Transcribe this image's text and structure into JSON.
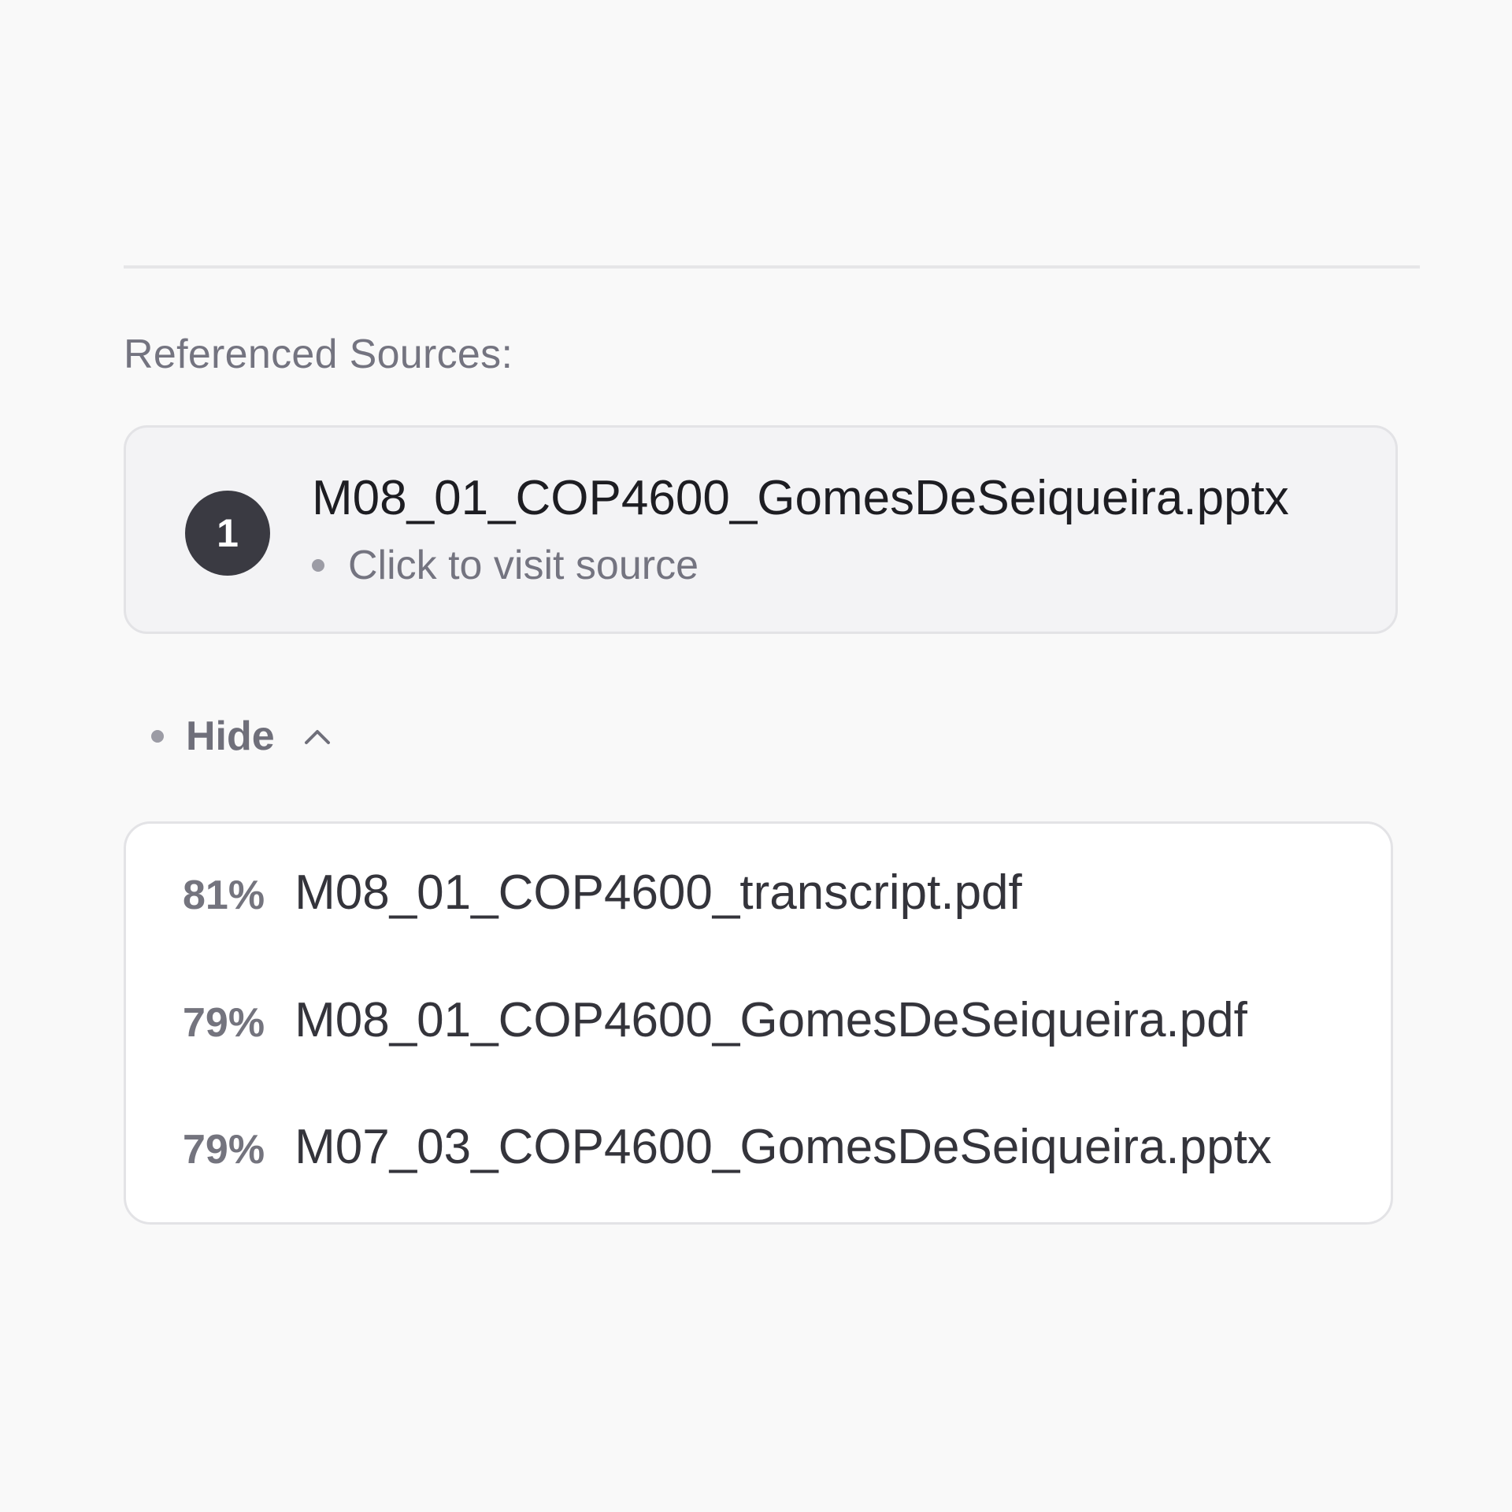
{
  "section_label": "Referenced Sources:",
  "primary_source": {
    "number": "1",
    "title": "M08_01_COP4600_GomesDeSeiqueira.pptx",
    "subtitle": "Click to visit source"
  },
  "toggle": {
    "label": "Hide",
    "icon": "chevron-up-icon"
  },
  "related_sources": [
    {
      "score": "81%",
      "name": "M08_01_COP4600_transcript.pdf"
    },
    {
      "score": "79%",
      "name": "M08_01_COP4600_GomesDeSeiqueira.pdf"
    },
    {
      "score": "79%",
      "name": "M07_03_COP4600_GomesDeSeiqueira.pptx"
    }
  ],
  "colors": {
    "background": "#f9f9f9",
    "badge": "#3a3a42",
    "muted_text": "#747480",
    "primary_text": "#1d1d22"
  }
}
